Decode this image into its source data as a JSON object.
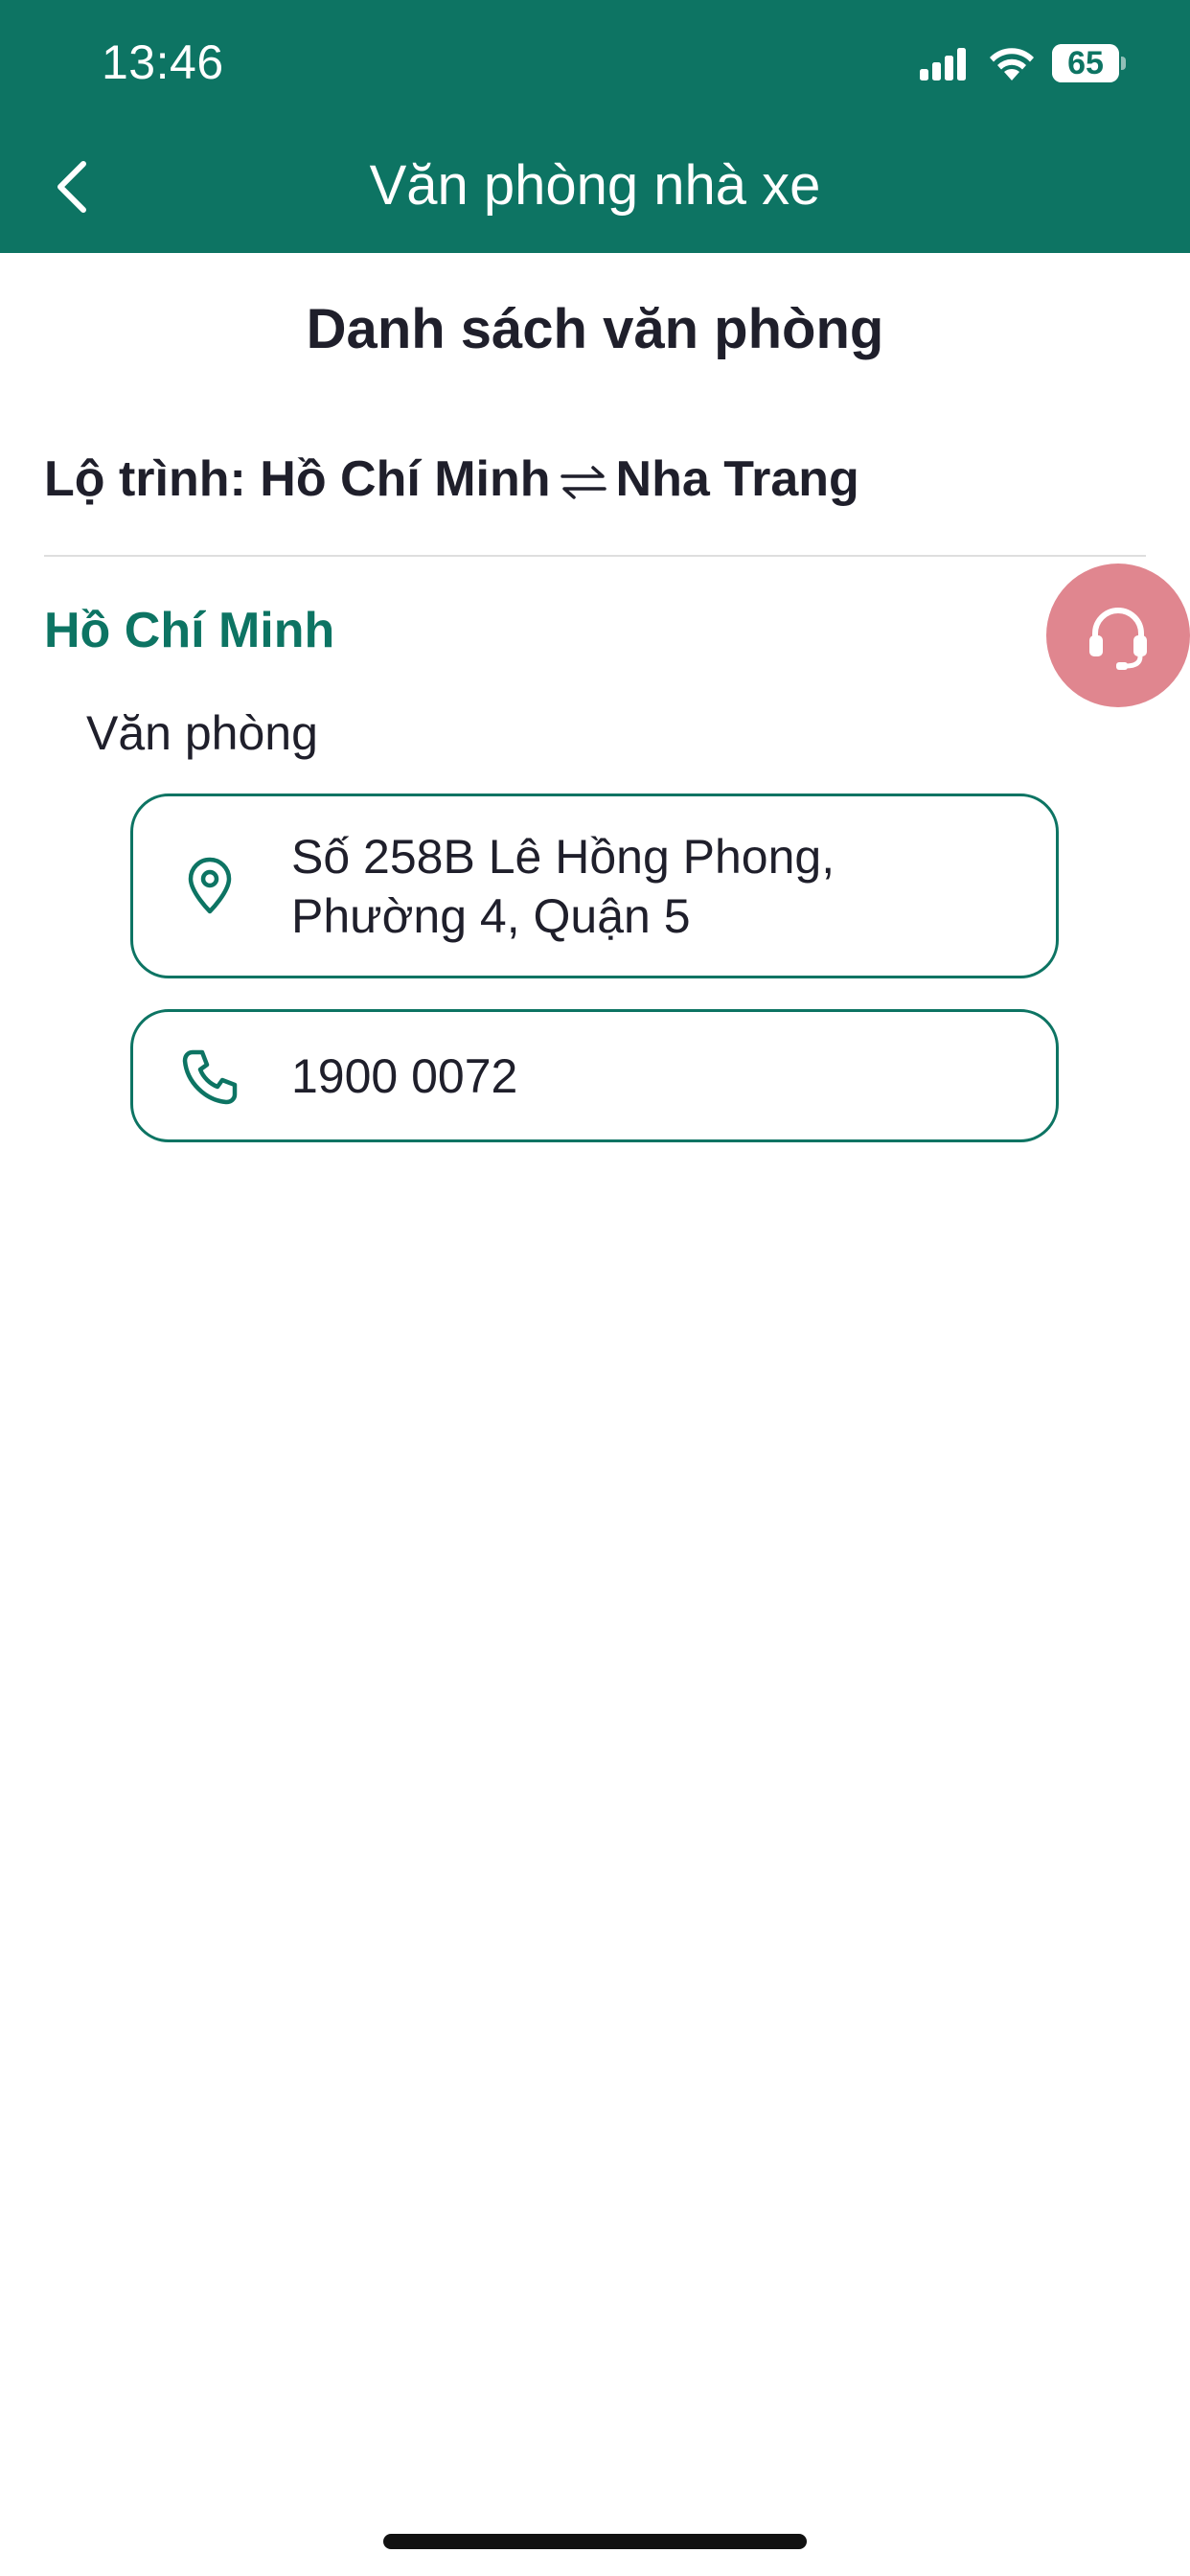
{
  "status_bar": {
    "time": "13:46",
    "battery": "65",
    "battery_level": 0.65,
    "signal_icon": "cellular-signal-icon",
    "wifi_icon": "wifi-icon"
  },
  "nav": {
    "back_icon": "chevron-left-icon",
    "title": "Văn phòng nhà xe"
  },
  "section_title": "Danh sách văn phòng",
  "route": {
    "label": "Lộ trình: Hồ Chí Minh",
    "destination": "Nha Trang",
    "swap_icon": "swap-arrows-icon"
  },
  "city": {
    "name": "Hồ Chí Minh",
    "office_label": "Văn phòng",
    "address": "Số 258B Lê Hồng Phong, Phường 4, Quận 5",
    "address_icon": "map-pin-icon",
    "phone": "1900 0072",
    "phone_icon": "phone-icon"
  },
  "support_button": {
    "icon": "headset-icon"
  },
  "colors": {
    "primary": "#0d7463",
    "support": "#e0868f",
    "text": "#1f1f2b",
    "divider": "#dedede"
  }
}
